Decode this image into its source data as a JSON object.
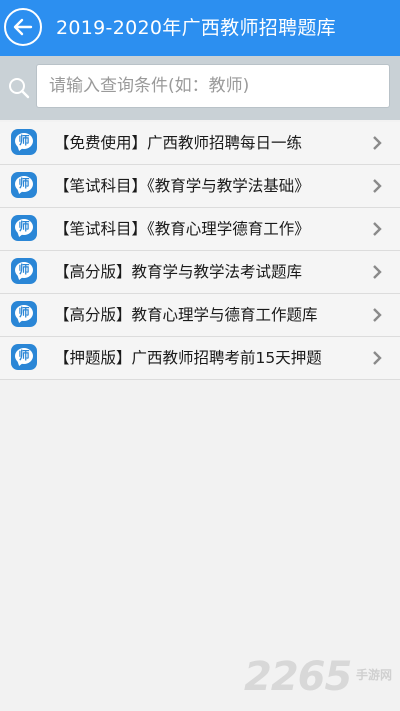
{
  "header": {
    "title": "2019-2020年广西教师招聘题库",
    "back_icon": "back-arrow-icon"
  },
  "search": {
    "placeholder": "请输入查询条件(如：教师)",
    "value": "",
    "icon": "search-icon"
  },
  "list": {
    "icon_glyph": "师",
    "items": [
      {
        "label": "【免费使用】广西教师招聘每日一练"
      },
      {
        "label": "【笔试科目】《教育学与教学法基础》"
      },
      {
        "label": "【笔试科目】《教育心理学德育工作》"
      },
      {
        "label": "【高分版】教育学与教学法考试题库"
      },
      {
        "label": "【高分版】教育心理学与德育工作题库"
      },
      {
        "label": "【押题版】广西教师招聘考前15天押题"
      }
    ]
  },
  "watermark": {
    "number": "2265",
    "sub": "手游网"
  },
  "colors": {
    "header_bg": "#2c8ff0",
    "search_bar_bg": "#c9d1d6",
    "icon_bg": "#2a86d6"
  }
}
